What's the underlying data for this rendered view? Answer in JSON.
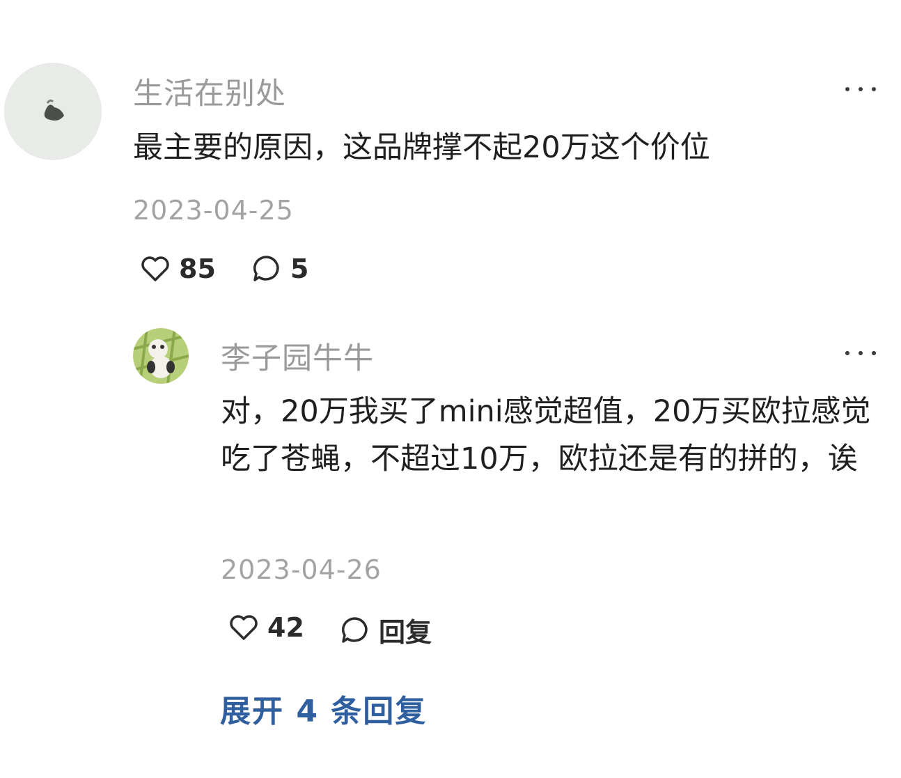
{
  "comment": {
    "username": "生活在别处",
    "text": "最主要的原因，这品牌撑不起20万这个价位",
    "date": "2023-04-25",
    "likes": "85",
    "replies": "5"
  },
  "reply": {
    "username": "李子园牛牛",
    "text": "对，20万我买了mini感觉超值，20万买欧拉感觉吃了苍蝇，不超过10万，欧拉还是有的拼的，诶",
    "date": "2023-04-26",
    "likes": "42",
    "reply_label": "回复"
  },
  "expand_label": "展开 4 条回复",
  "colors": {
    "link": "#2f5f9e",
    "meta": "#9a9a9a"
  },
  "icons": [
    "heart-icon",
    "comment-bubble-icon",
    "more-dots-icon"
  ]
}
